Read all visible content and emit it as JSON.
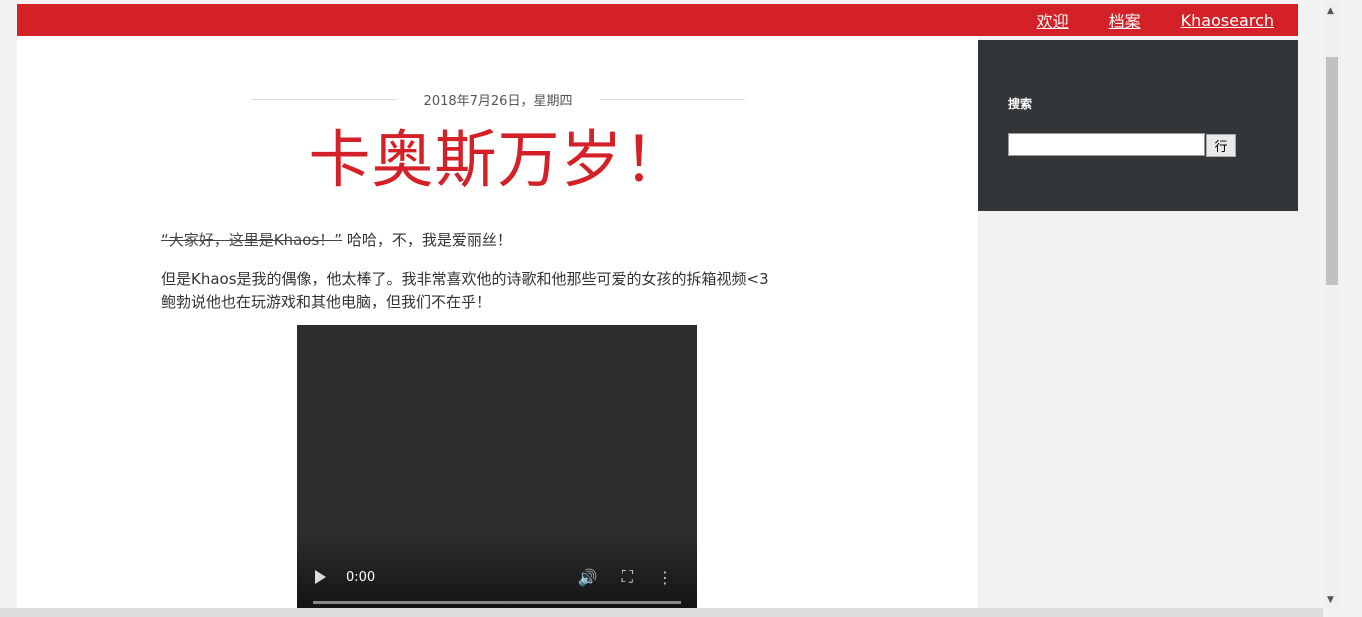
{
  "nav": {
    "items": [
      {
        "label": "欢迎"
      },
      {
        "label": "档案"
      },
      {
        "label": "Khaosearch"
      }
    ]
  },
  "post": {
    "date": "2018年7月26日，星期四",
    "title": "卡奥斯万岁！",
    "p1_strike": "“大家好，这里是Khaos！”",
    "p1_rest": " 哈哈，不，我是爱丽丝！",
    "p2_line1": "但是Khaos是我的偶像，他太棒了。我非常喜欢他的诗歌和他那些可爱的女孩的拆箱视频<3",
    "p2_line2": "鲍勃说他也在玩游戏和其他电脑，但我们不在乎！"
  },
  "video": {
    "time": "0:00",
    "progress": 0
  },
  "sidebar": {
    "title": "搜索",
    "search_value": "",
    "button_label": "行"
  },
  "colors": {
    "accent": "#d42027",
    "sidebar_bg": "#333638"
  }
}
